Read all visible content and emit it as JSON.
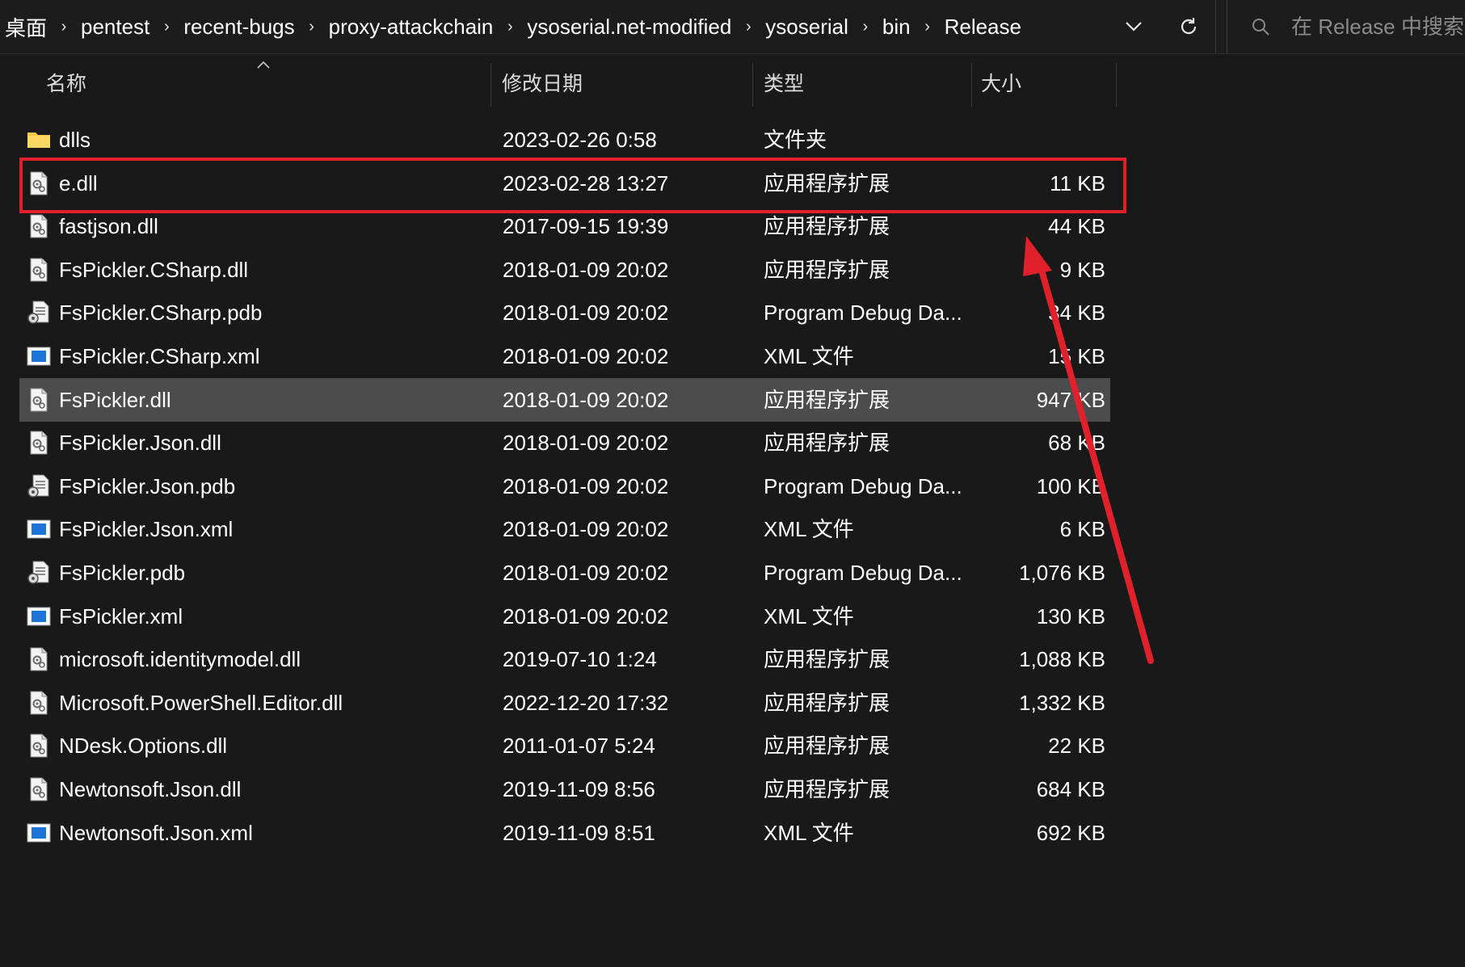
{
  "address_bar": {
    "crumbs": [
      "桌面",
      "pentest",
      "recent-bugs",
      "proxy-attackchain",
      "ysoserial.net-modified",
      "ysoserial",
      "bin",
      "Release"
    ],
    "separator": "›",
    "search_placeholder": "在 Release 中搜索"
  },
  "columns": {
    "name": "名称",
    "date": "修改日期",
    "type": "类型",
    "size": "大小",
    "sorted_by": "name"
  },
  "files": [
    {
      "name": "dlls",
      "date": "2023-02-26 0:58",
      "type": "文件夹",
      "size": "",
      "icon": "folder-icon"
    },
    {
      "name": "e.dll",
      "date": "2023-02-28 13:27",
      "type": "应用程序扩展",
      "size": "11 KB",
      "icon": "dll-file-icon"
    },
    {
      "name": "fastjson.dll",
      "date": "2017-09-15 19:39",
      "type": "应用程序扩展",
      "size": "44 KB",
      "icon": "dll-file-icon"
    },
    {
      "name": "FsPickler.CSharp.dll",
      "date": "2018-01-09 20:02",
      "type": "应用程序扩展",
      "size": "9 KB",
      "icon": "dll-file-icon"
    },
    {
      "name": "FsPickler.CSharp.pdb",
      "date": "2018-01-09 20:02",
      "type": "Program Debug Da...",
      "size": "34 KB",
      "icon": "pdb-file-icon"
    },
    {
      "name": "FsPickler.CSharp.xml",
      "date": "2018-01-09 20:02",
      "type": "XML 文件",
      "size": "15 KB",
      "icon": "xml-file-icon"
    },
    {
      "name": "FsPickler.dll",
      "date": "2018-01-09 20:02",
      "type": "应用程序扩展",
      "size": "947 KB",
      "icon": "dll-file-icon"
    },
    {
      "name": "FsPickler.Json.dll",
      "date": "2018-01-09 20:02",
      "type": "应用程序扩展",
      "size": "68 KB",
      "icon": "dll-file-icon"
    },
    {
      "name": "FsPickler.Json.pdb",
      "date": "2018-01-09 20:02",
      "type": "Program Debug Da...",
      "size": "100 KB",
      "icon": "pdb-file-icon"
    },
    {
      "name": "FsPickler.Json.xml",
      "date": "2018-01-09 20:02",
      "type": "XML 文件",
      "size": "6 KB",
      "icon": "xml-file-icon"
    },
    {
      "name": "FsPickler.pdb",
      "date": "2018-01-09 20:02",
      "type": "Program Debug Da...",
      "size": "1,076 KB",
      "icon": "pdb-file-icon"
    },
    {
      "name": "FsPickler.xml",
      "date": "2018-01-09 20:02",
      "type": "XML 文件",
      "size": "130 KB",
      "icon": "xml-file-icon"
    },
    {
      "name": "microsoft.identitymodel.dll",
      "date": "2019-07-10 1:24",
      "type": "应用程序扩展",
      "size": "1,088 KB",
      "icon": "dll-file-icon"
    },
    {
      "name": "Microsoft.PowerShell.Editor.dll",
      "date": "2022-12-20 17:32",
      "type": "应用程序扩展",
      "size": "1,332 KB",
      "icon": "dll-file-icon"
    },
    {
      "name": "NDesk.Options.dll",
      "date": "2011-01-07 5:24",
      "type": "应用程序扩展",
      "size": "22 KB",
      "icon": "dll-file-icon"
    },
    {
      "name": "Newtonsoft.Json.dll",
      "date": "2019-11-09 8:56",
      "type": "应用程序扩展",
      "size": "684 KB",
      "icon": "dll-file-icon"
    },
    {
      "name": "Newtonsoft.Json.xml",
      "date": "2019-11-09 8:51",
      "type": "XML 文件",
      "size": "692 KB",
      "icon": "xml-file-icon"
    }
  ],
  "selected_file": "FsPickler.dll",
  "annotations": {
    "highlighted_file": "e.dll",
    "highlight_color": "#e0202a",
    "arrow_color": "#e0202a"
  },
  "colors": {
    "background": "#191919",
    "selected_row": "#4c4c4c",
    "folder_yellow": "#f5c84c",
    "xml_blue": "#1e73d8"
  }
}
